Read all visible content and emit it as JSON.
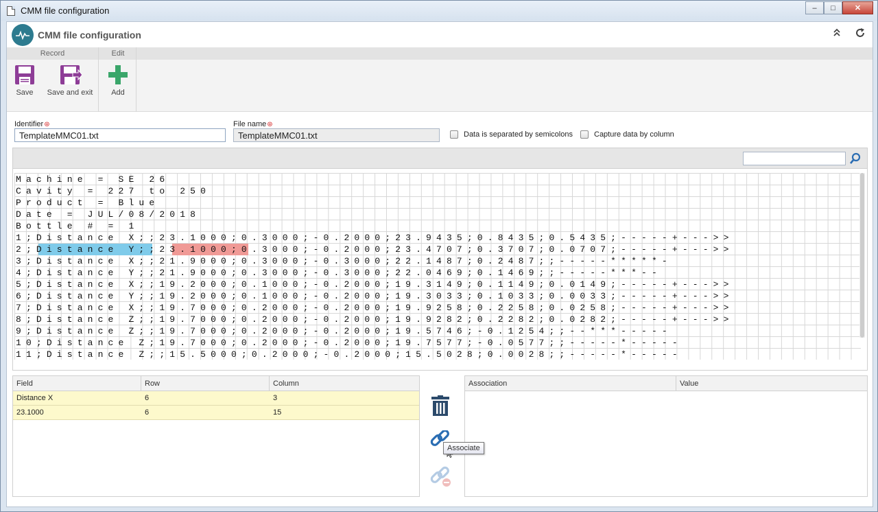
{
  "window": {
    "title": "CMM file configuration",
    "min": "–",
    "max": "□",
    "close": "✕"
  },
  "header": {
    "title": "CMM file configuration"
  },
  "ribbon": {
    "groups": [
      "Record",
      "Edit"
    ],
    "buttons": {
      "save": "Save",
      "save_exit": "Save and exit",
      "add": "Add"
    }
  },
  "form": {
    "identifier_label": "Identifier",
    "identifier_value": "TemplateMMC01.txt",
    "filename_label": "File name",
    "filename_value": "TemplateMMC01.txt",
    "semicolons_label": "Data is separated by semicolons",
    "column_label": "Capture data by column"
  },
  "file_lines": [
    "Machine = SE 26",
    "Cavity = 227 to 250",
    "Product = Blue",
    "Date = JUL/08/2018",
    "Bottle # = 1",
    "1;Distance X;;23.1000;0.3000;-0.2000;23.9435;0.8435;0.5435;-----+--->>",
    "2;Distance Y;;23.1000;0.3000;-0.2000;23.4707;0.3707;0.0707;-----+--->>",
    "3;Distance X;;21.9000;0.3000;-0.3000;22.1487;0.2487;;-----*****-",
    "4;Distance Y;;21.9000;0.3000;-0.3000;22.0469;0.1469;;-----***--",
    "5;Distance X;;19.2000;0.1000;-0.2000;19.3149;0.1149;0.0149;-----+--->>",
    "6;Distance Y;;19.2000;0.1000;-0.2000;19.3033;0.1033;0.0033;-----+--->>",
    "7;Distance X;;19.7000;0.2000;-0.2000;19.9258;0.2258;0.0258;-----+--->>",
    "8;Distance Z;;19.7000;0.2000;-0.2000;19.9282;0.2282;0.0282;-----+--->>",
    "9;Distance Z;;19.7000;0.2000;-0.2000;19.5746;-0.1254;;--***-----",
    "10;Distance Z;19.7000;0.2000;-0.2000;19.7577;-0.0577;;-----*-----",
    "11;Distance Z;;15.5000;0.2000;-0.2000;15.5028;0.0028;;-----*-----"
  ],
  "fields_table": {
    "headers": [
      "Field",
      "Row",
      "Column"
    ],
    "rows": [
      [
        "Distance X",
        "6",
        "3"
      ],
      [
        "23.1000",
        "6",
        "15"
      ]
    ]
  },
  "assoc_table": {
    "headers": [
      "Association",
      "Value"
    ]
  },
  "tooltip": "Associate",
  "icons": [
    "document-icon",
    "logo-icon",
    "collapse-icon",
    "refresh-icon",
    "save-icon",
    "save-exit-icon",
    "add-icon",
    "search-icon",
    "trash-icon",
    "associate-icon",
    "disassociate-icon"
  ]
}
